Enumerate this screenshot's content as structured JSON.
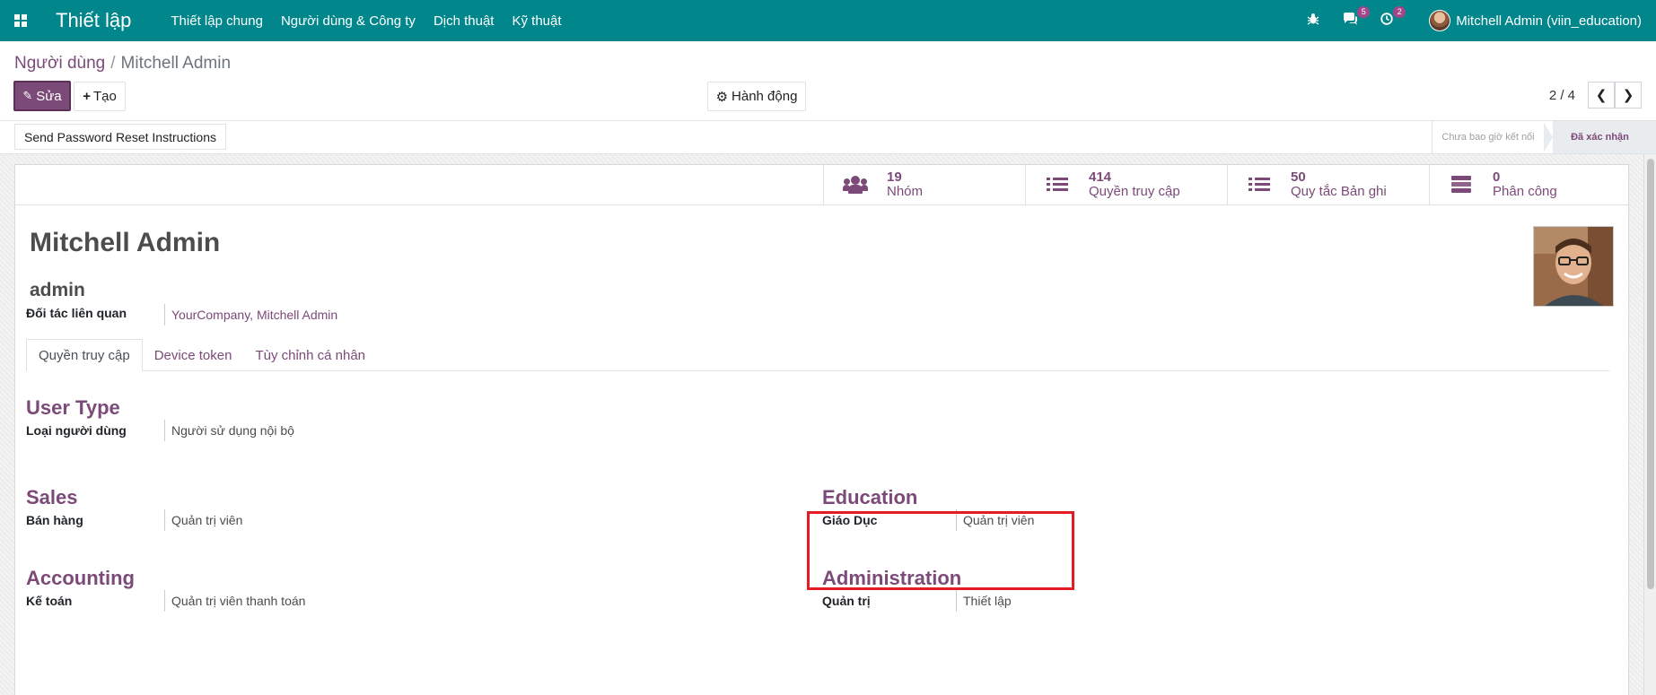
{
  "navbar": {
    "brand": "Thiết lập",
    "menu": [
      "Thiết lập chung",
      "Người dùng & Công ty",
      "Dịch thuật",
      "Kỹ thuật"
    ],
    "messages_badge": "5",
    "activities_badge": "2",
    "user": "Mitchell Admin (viin_education)",
    "color": "#00868b"
  },
  "breadcrumb": {
    "parent": "Người dùng",
    "separator": "/",
    "current": "Mitchell Admin"
  },
  "control_panel": {
    "edit_label": "Sửa",
    "create_label": "Tạo",
    "action_label": "Hành động",
    "pager_value": "2 / 4"
  },
  "statusbar": {
    "reset_label": "Send Password Reset Instructions",
    "state_never": "Chưa bao giờ kết nối",
    "state_confirmed": "Đã xác nhận"
  },
  "stats": [
    {
      "value": "19",
      "label": "Nhóm",
      "icon": "users-icon"
    },
    {
      "value": "414",
      "label": "Quyền truy cập",
      "icon": "list-icon"
    },
    {
      "value": "50",
      "label": "Quy tắc Bản ghi",
      "icon": "list-icon"
    },
    {
      "value": "0",
      "label": "Phân công",
      "icon": "tasks-icon"
    }
  ],
  "user": {
    "name": "Mitchell Admin",
    "login": "admin",
    "partner_label": "Đối tác liên quan",
    "partner_value": "YourCompany, Mitchell Admin"
  },
  "tabs": [
    "Quyền truy cập",
    "Device token",
    "Tùy chỉnh cá nhân"
  ],
  "groups": {
    "user_type": {
      "title": "User Type",
      "label": "Loại người dùng",
      "value": "Người sử dụng nội bộ"
    },
    "sales": {
      "title": "Sales",
      "label": "Bán hàng",
      "value": "Quản trị viên"
    },
    "education": {
      "title": "Education",
      "label": "Giáo Dục",
      "value": "Quản trị viên"
    },
    "accounting": {
      "title": "Accounting",
      "label": "Kế toán",
      "value": "Quản trị viên thanh toán"
    },
    "administration": {
      "title": "Administration",
      "label": "Quản trị",
      "value": "Thiết lập"
    }
  },
  "colors": {
    "primary": "#7c4a78",
    "highlight": "#e41d24"
  }
}
